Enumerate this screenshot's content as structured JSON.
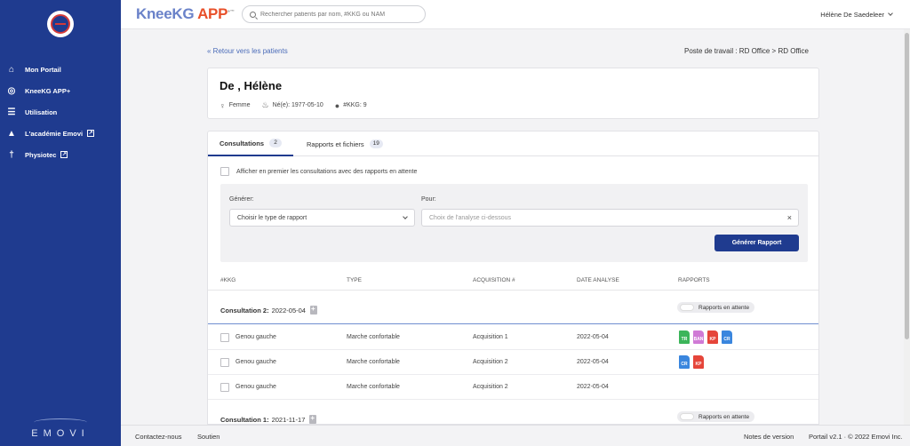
{
  "sidebar": {
    "items": [
      {
        "label": "Mon Portail",
        "icon": "home-icon"
      },
      {
        "label": "KneeKG APP+",
        "icon": "kneekg-icon"
      },
      {
        "label": "Utilisation",
        "icon": "database-icon"
      },
      {
        "label": "L'académie Emovi",
        "icon": "graduation-cap-icon",
        "external": true
      },
      {
        "label": "Physiotec",
        "icon": "physio-icon",
        "external": true
      }
    ],
    "brand": "EMOVI"
  },
  "header": {
    "brand_a": "KneeKG",
    "brand_b": " APP",
    "brand_sup": "+™",
    "search_placeholder": "Rechercher patients par nom, #KKG ou NAM",
    "user": "Hélène De Saedeleer"
  },
  "nav": {
    "back_link": "« Retour vers les patients",
    "workstation": "Poste de travail : RD Office > RD Office"
  },
  "patient": {
    "name": "De              , Hélène",
    "sex": "Femme",
    "birth": "Né(e): 1977-05-10",
    "kkg": "#KKG: 9"
  },
  "tabs": [
    {
      "label": "Consultations",
      "count": "2"
    },
    {
      "label": "Rapports et fichiers",
      "count": "19"
    }
  ],
  "filter_label": "Afficher en premier les consultations avec des rapports en attente",
  "generate": {
    "generer_label": "Générer:",
    "pour_label": "Pour:",
    "type_select": "Choisir le type de rapport",
    "analysis_placeholder": "Choix de l'analyse ci-dessous",
    "clear": "×",
    "button": "Générer Rapport"
  },
  "table": {
    "headers": [
      "#KKG",
      "TYPE",
      "ACQUISITION #",
      "DATE ANALYSE",
      "RAPPORTS"
    ],
    "toggle_label": "Rapports en attente",
    "consultations": [
      {
        "title": "Consultation 2:",
        "date": "2022-05-04",
        "rows": [
          {
            "knee": "Genou gauche",
            "type": "Marche confortable",
            "acq": "Acquisition 1",
            "date": "2022-05-04",
            "reports": [
              {
                "code": "TR",
                "color": "#3cb55a"
              },
              {
                "code": "BAN",
                "color": "#d07ad6"
              },
              {
                "code": "KP",
                "color": "#e5453a"
              },
              {
                "code": "CR",
                "color": "#3a86de"
              }
            ]
          },
          {
            "knee": "Genou gauche",
            "type": "Marche confortable",
            "acq": "Acquisition 2",
            "date": "2022-05-04",
            "reports": [
              {
                "code": "CR",
                "color": "#3a86de"
              },
              {
                "code": "KP",
                "color": "#e5453a"
              }
            ]
          },
          {
            "knee": "Genou gauche",
            "type": "Marche confortable",
            "acq": "Acquisition 2",
            "date": "2022-05-04",
            "reports": []
          }
        ]
      },
      {
        "title": "Consultation 1:",
        "date": "2021-11-17",
        "rows": []
      }
    ]
  },
  "footer": {
    "contact": "Contactez-nous",
    "support": "Soutien",
    "release_notes": "Notes de version",
    "version": "Portail v2.1 · © 2022 Emovi Inc."
  }
}
